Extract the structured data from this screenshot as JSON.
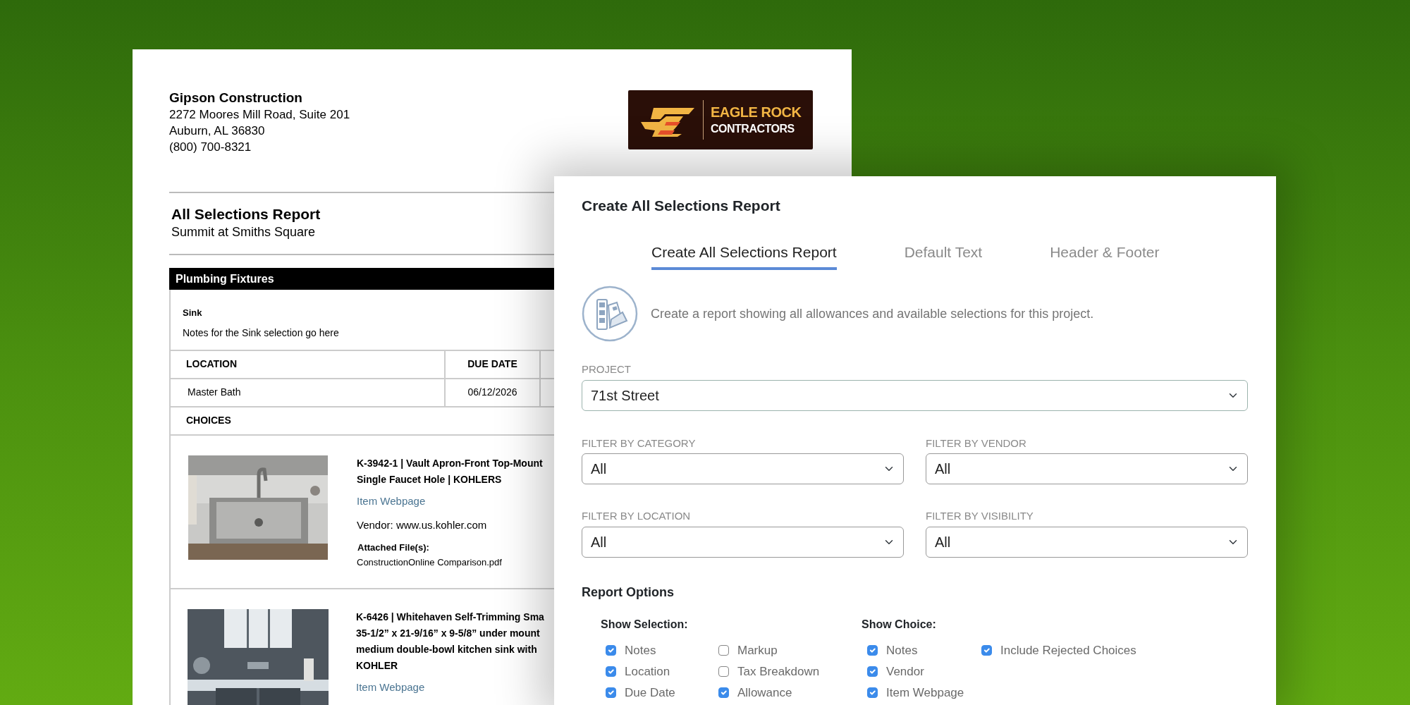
{
  "report_document": {
    "company": {
      "name": "Gipson Construction",
      "address_lines": [
        "2272 Moores Mill Road, Suite 201",
        "Auburn, AL 36830",
        "(800) 700-8321"
      ]
    },
    "logo": {
      "line_1": "EAGLE ROCK",
      "line_2": "CONTRACTORS"
    },
    "title": "All Selections Report",
    "subtitle": "Summit at Smiths Square",
    "category": "Plumbing Fixtures",
    "selection": {
      "name": "Sink",
      "notes": "Notes for the Sink selection go here"
    },
    "table": {
      "columns": [
        "LOCATION",
        "DUE DATE"
      ],
      "rows": [
        [
          "Master Bath",
          "06/12/2026"
        ]
      ]
    },
    "choices_heading": "CHOICES",
    "choices": [
      {
        "title": "K-3942-1 | Vault Apron-Front Top-Mount\nSingle Faucet Hole | KOHLERS",
        "link": "Item Webpage",
        "vendor": "Vendor: www.us.kohler.com",
        "attachments_label": "Attached File(s):",
        "attachment": "ConstructionOnline Comparison.pdf"
      },
      {
        "title": "K-6426 | Whitehaven Self-Trimming Sma\n35-1/2” x 21-9/16” x 9-5/8” under mount\nmedium double-bowl kitchen sink with\nKOHLER",
        "link": "Item Webpage"
      }
    ]
  },
  "dialog": {
    "title": "Create All Selections Report",
    "tabs": [
      {
        "label": "Create All Selections Report",
        "selected": true
      },
      {
        "label": "Default Text",
        "selected": false
      },
      {
        "label": "Header & Footer",
        "selected": false
      }
    ],
    "description": "Create a report showing all allowances and available selections for this project.",
    "project": {
      "label": "PROJECT",
      "value": "71st Street"
    },
    "filters": [
      {
        "label": "FILTER BY CATEGORY",
        "value": "All"
      },
      {
        "label": "FILTER BY VENDOR",
        "value": "All"
      },
      {
        "label": "FILTER BY LOCATION",
        "value": "All"
      },
      {
        "label": "FILTER BY VISIBILITY",
        "value": "All"
      }
    ],
    "report_options": {
      "title": "Report Options",
      "groups": [
        {
          "title": "Show Selection:",
          "options": [
            {
              "label": "Notes",
              "checked": true
            },
            {
              "label": "Location",
              "checked": true
            },
            {
              "label": "Due Date",
              "checked": true
            },
            {
              "label": "Markup",
              "checked": false
            },
            {
              "label": "Tax Breakdown",
              "checked": false
            },
            {
              "label": "Allowance",
              "checked": true
            }
          ]
        },
        {
          "title": "Show Choice:",
          "options": [
            {
              "label": "Notes",
              "checked": true
            },
            {
              "label": "Vendor",
              "checked": true
            },
            {
              "label": "Item Webpage",
              "checked": true
            },
            {
              "label": "Include Rejected Choices",
              "checked": true
            }
          ]
        }
      ]
    }
  }
}
